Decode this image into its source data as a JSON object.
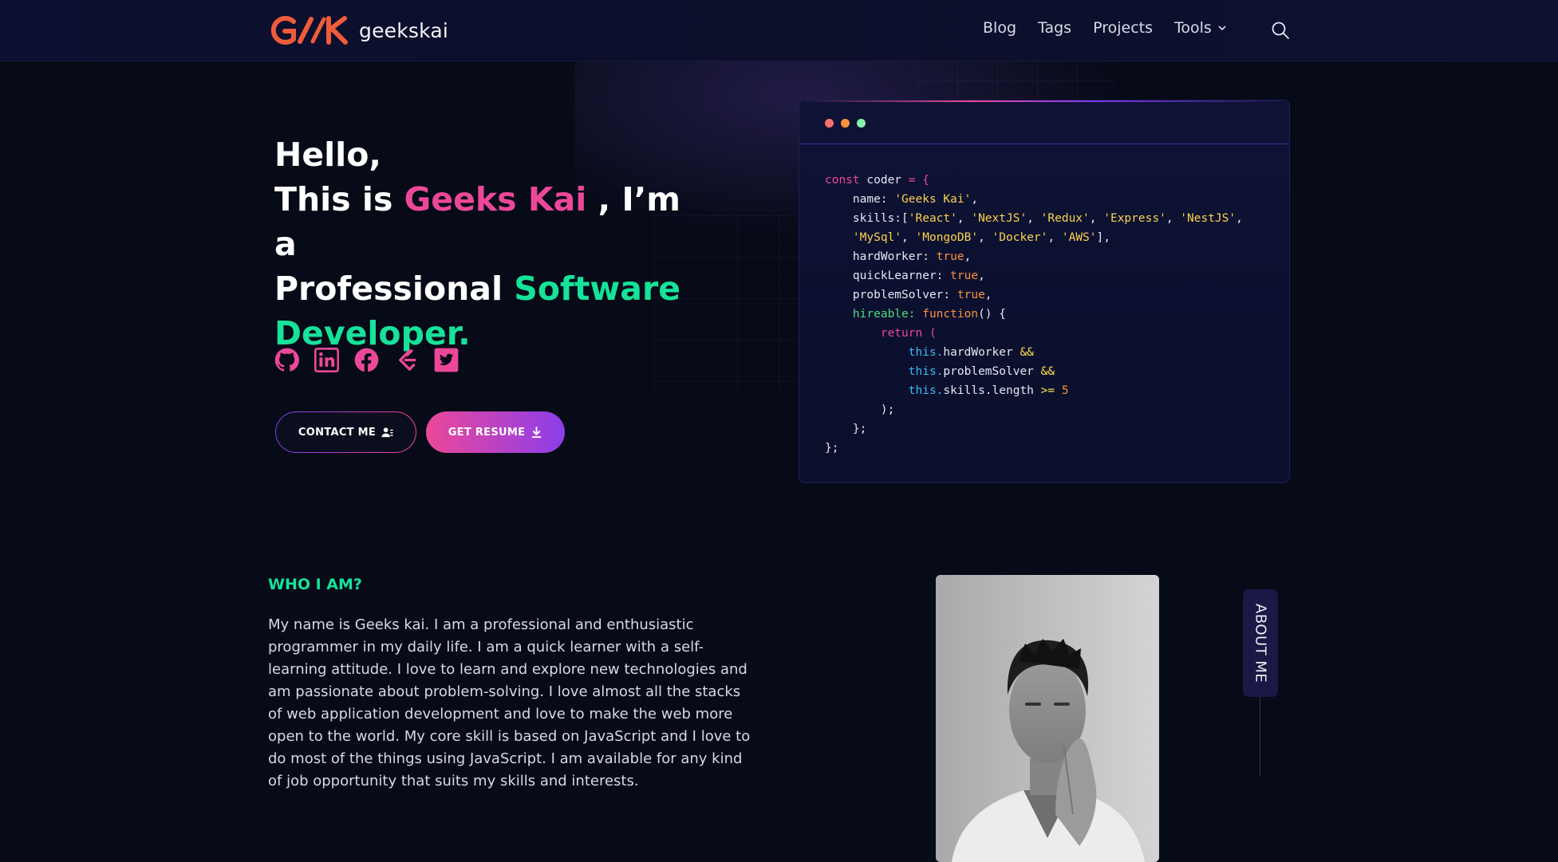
{
  "nav": {
    "brand": "geekskai",
    "links": [
      "Blog",
      "Tags",
      "Projects"
    ],
    "tools_label": "Tools"
  },
  "hero": {
    "line1": "Hello,",
    "this_is": "This is ",
    "name": "Geeks Kai",
    "im_a": " , I’m a",
    "professional": "Professional ",
    "software": "Software",
    "developer": "Developer."
  },
  "socials": [
    "github-icon",
    "linkedin-icon",
    "facebook-icon",
    "leetcode-icon",
    "twitter-icon"
  ],
  "buttons": {
    "contact": "CONTACT ME",
    "resume": "GET RESUME"
  },
  "code": {
    "declare_kw": "const",
    "var": " coder ",
    "assign": "= {",
    "name_key": "    name: ",
    "name_val": "'Geeks Kai'",
    "skills_key": "    skills:[",
    "skills_line1": [
      "'React'",
      "'NextJS'",
      "'Redux'",
      "'Express'",
      "'NestJS'"
    ],
    "skills_line2": [
      "'MySql'",
      "'MongoDB'",
      "'Docker'",
      "'AWS'"
    ],
    "hard_key": "    hardWorker: ",
    "quick_key": "    quickLearner: ",
    "problem_key": "    problemSolver: ",
    "true_val": "true",
    "hireable_key": "    hireable: ",
    "function_kw": "function",
    "function_tail": "() {",
    "return_kw": "        return (",
    "this_kw": "this.",
    "hard_prop": "hardWorker ",
    "problem_prop": "problemSolver ",
    "skills_prop": "skills.length ",
    "and_op": "&&",
    "gte_op": ">=",
    "five": " 5",
    "close_paren": "        );",
    "close_fn": "    };",
    "close_obj": "};"
  },
  "about": {
    "heading": "WHO I AM?",
    "text": "My name is Geeks kai. I am a professional and enthusiastic programmer in my daily life. I am a quick learner with a self-learning attitude. I love to learn and explore new technologies and am passionate about problem-solving. I love almost all the stacks of web application development and love to make the web more open to the world. My core skill is based on JavaScript and I love to do most of the things using JavaScript. I am available for any kind of job opportunity that suits my skills and interests.",
    "tab_label": "ABOUT ME"
  },
  "colors": {
    "pink": "#ec4899",
    "green": "#16e29a",
    "purple": "#8b3dea",
    "dot_red": "#f87171",
    "dot_orange": "#fb923c",
    "dot_green": "#86efac"
  }
}
